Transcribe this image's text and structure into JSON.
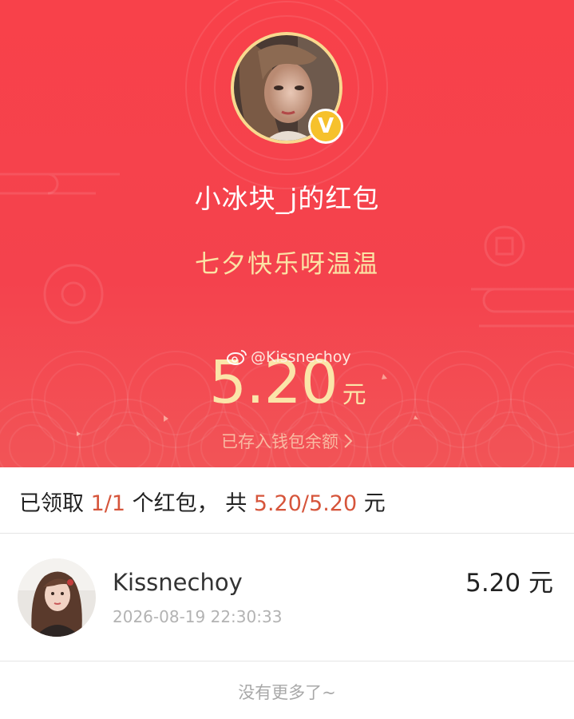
{
  "packet": {
    "sender_title": "小冰块_j的红包",
    "greeting": "七夕快乐呀温温",
    "watermark": "@Kissnechoy",
    "amount": "5.20",
    "amount_unit": "元",
    "wallet_link": "已存入钱包余额",
    "badge_letter": "V"
  },
  "summary": {
    "prefix": "已领取 ",
    "count": "1/1",
    "middle": " 个红包， 共 ",
    "total": "5.20/5.20",
    "suffix": " 元"
  },
  "records": [
    {
      "name": "Kissnechoy",
      "time": "2026-08-19 22:30:33",
      "amount": "5.20 元"
    }
  ],
  "footer": "没有更多了~",
  "colors": {
    "hero": "#f4424d",
    "gold": "#fbe5a9",
    "highlight": "#d6553b",
    "badge": "#f6c12c"
  },
  "icons": {
    "badge": "verified-v-icon",
    "wallet_arrow": "chevron-right-icon",
    "watermark": "weibo-icon"
  }
}
